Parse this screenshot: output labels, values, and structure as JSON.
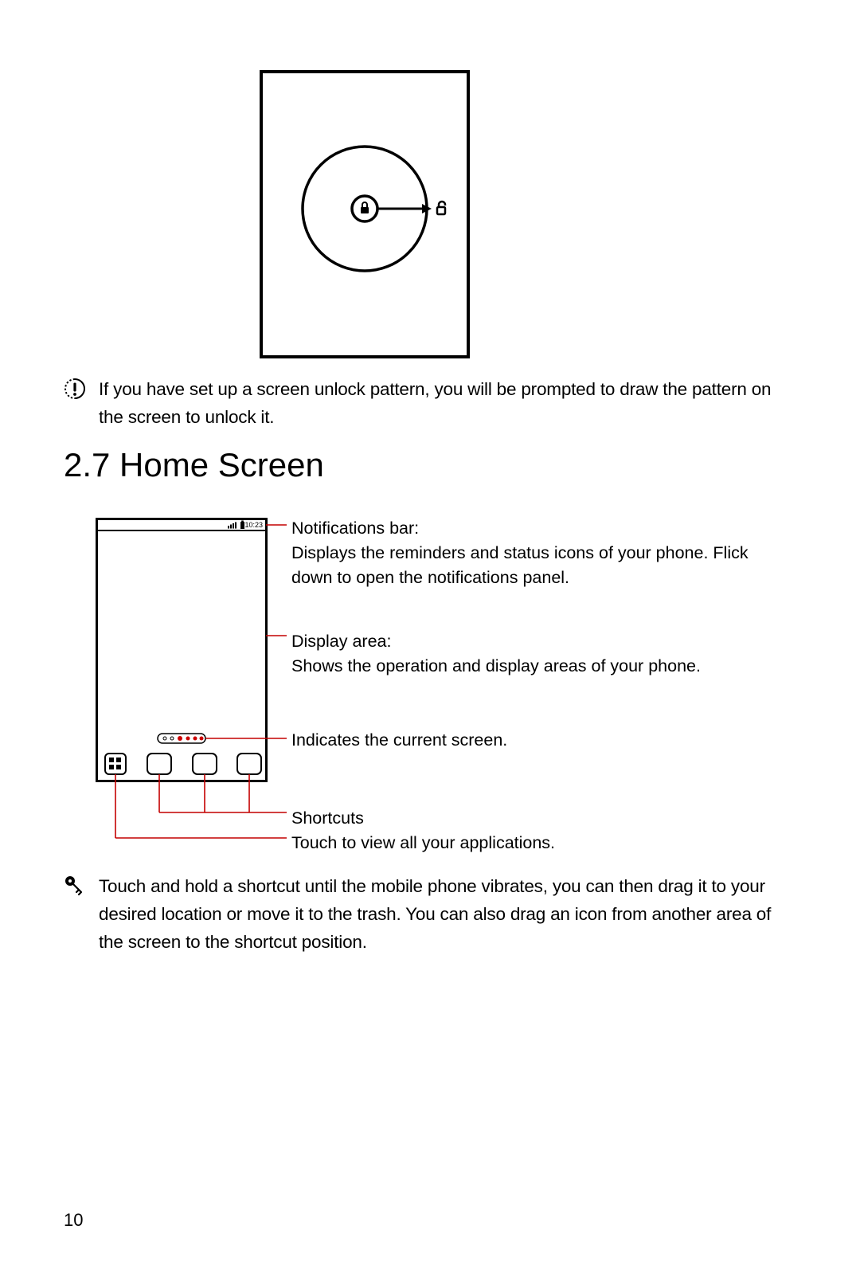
{
  "note": {
    "text": "If you have set up a screen unlock pattern, you will be prompted to draw the pattern on the screen to unlock it."
  },
  "heading": "2.7  Home Screen",
  "diagram": {
    "status_time": "10:23",
    "callouts": {
      "notifications": {
        "title": "Notifications bar:",
        "body": "Displays the reminders and status icons of your phone. Flick down to open the notifications panel."
      },
      "display_area": {
        "title": "Display area:",
        "body": "Shows the operation and display areas of your phone."
      },
      "indicator": {
        "title": "Indicates the current screen."
      },
      "shortcuts": {
        "title": "Shortcuts"
      },
      "apps": {
        "title": "Touch to view all your applications."
      }
    }
  },
  "tip": {
    "text": "Touch and hold a shortcut until the mobile phone vibrates, you can then drag it to your desired location or move it to the trash. You can also drag an icon from another area of the screen to the shortcut position."
  },
  "page_number": "10"
}
